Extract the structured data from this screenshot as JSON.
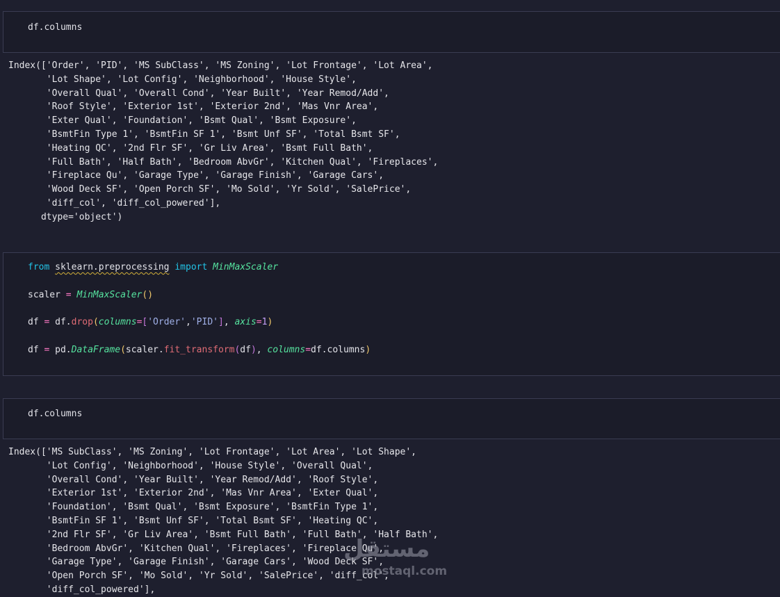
{
  "cells": [
    {
      "input": "df.columns"
    },
    {
      "input": "df.columns"
    }
  ],
  "outputs": [
    {
      "lines": [
        "Index(['Order', 'PID', 'MS SubClass', 'MS Zoning', 'Lot Frontage', 'Lot Area',",
        "       'Lot Shape', 'Lot Config', 'Neighborhood', 'House Style',",
        "       'Overall Qual', 'Overall Cond', 'Year Built', 'Year Remod/Add',",
        "       'Roof Style', 'Exterior 1st', 'Exterior 2nd', 'Mas Vnr Area',",
        "       'Exter Qual', 'Foundation', 'Bsmt Qual', 'Bsmt Exposure',",
        "       'BsmtFin Type 1', 'BsmtFin SF 1', 'Bsmt Unf SF', 'Total Bsmt SF',",
        "       'Heating QC', '2nd Flr SF', 'Gr Liv Area', 'Bsmt Full Bath',",
        "       'Full Bath', 'Half Bath', 'Bedroom AbvGr', 'Kitchen Qual', 'Fireplaces',",
        "       'Fireplace Qu', 'Garage Type', 'Garage Finish', 'Garage Cars',",
        "       'Wood Deck SF', 'Open Porch SF', 'Mo Sold', 'Yr Sold', 'SalePrice',",
        "       'diff_col', 'diff_col_powered'],",
        "      dtype='object')"
      ]
    },
    {
      "lines": [
        "Index(['MS SubClass', 'MS Zoning', 'Lot Frontage', 'Lot Area', 'Lot Shape',",
        "       'Lot Config', 'Neighborhood', 'House Style', 'Overall Qual',",
        "       'Overall Cond', 'Year Built', 'Year Remod/Add', 'Roof Style',",
        "       'Exterior 1st', 'Exterior 2nd', 'Mas Vnr Area', 'Exter Qual',",
        "       'Foundation', 'Bsmt Qual', 'Bsmt Exposure', 'BsmtFin Type 1',",
        "       'BsmtFin SF 1', 'Bsmt Unf SF', 'Total Bsmt SF', 'Heating QC',",
        "       '2nd Flr SF', 'Gr Liv Area', 'Bsmt Full Bath', 'Full Bath', 'Half Bath',",
        "       'Bedroom AbvGr', 'Kitchen Qual', 'Fireplaces', 'Fireplace Qu',",
        "       'Garage Type', 'Garage Finish', 'Garage Cars', 'Wood Deck SF',",
        "       'Open Porch SF', 'Mo Sold', 'Yr Sold', 'SalePrice', 'diff_col',",
        "       'diff_col_powered'],"
      ]
    }
  ],
  "code_cell": {
    "t_from": "from",
    "t_module": "sklearn.preprocessing",
    "t_import": "import",
    "t_class": "MinMaxScaler",
    "t_scaler": "scaler",
    "t_eq": "=",
    "t_lp": "(",
    "t_rp": ")",
    "t_df": "df",
    "t_dfdot": "df.",
    "t_drop": "drop",
    "t_columns_kw": "columns",
    "t_lb": "[",
    "t_rb": "]",
    "t_order": "'Order'",
    "t_comma": ",",
    "t_pid": "'PID'",
    "t_axis": "axis",
    "t_one": "1",
    "t_pd": "pd.",
    "t_dataframe": "DataFrame",
    "t_scalerdot": "scaler.",
    "t_fit": "fit_transform",
    "t_df_cols": "df.columns"
  },
  "watermark": {
    "arabic": "مستقل",
    "latin": "mostaql.com"
  },
  "colors": {
    "background": "#1e1f2e",
    "cell_border": "#3a3c52",
    "keyword": "#22c3e6",
    "function": "#e06c75",
    "class": "#56e39f",
    "string": "#a0b0e8",
    "operator": "#ff79c6",
    "number": "#c6a0f6"
  }
}
